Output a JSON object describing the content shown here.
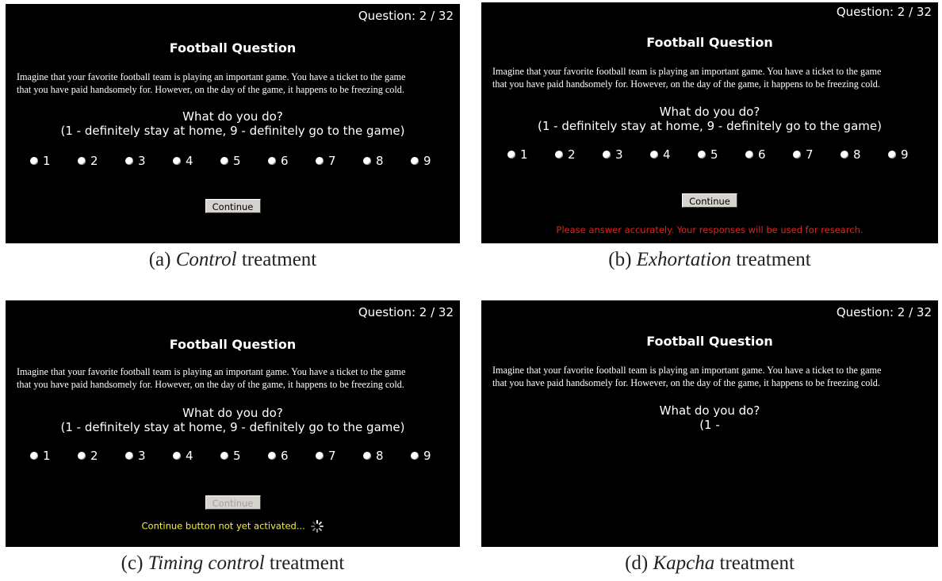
{
  "question_counter": "Question: 2 / 32",
  "question_title": "Football Question",
  "question_text_line1": "Imagine that your favorite football team is playing an important game. You have a ticket to the game",
  "question_text_line2": "that you have paid handsomely for. However, on the day of the game, it happens to be freezing cold.",
  "prompt_line1": "What do you do?",
  "prompt_line2": "(1 - definitely stay at home, 9 - definitely go to the game)",
  "prompt_line2_partial": "(1 -",
  "scale_options": [
    "1",
    "2",
    "3",
    "4",
    "5",
    "6",
    "7",
    "8",
    "9"
  ],
  "continue_label": "Continue",
  "exhortation_message": "Please answer accurately. Your responses will be used for research.",
  "timing_message": "Continue button not yet activated...",
  "captions": {
    "a": {
      "prefix": "(a) ",
      "name": "Control",
      "suffix": " treatment"
    },
    "b": {
      "prefix": "(b) ",
      "name": "Exhortation",
      "suffix": " treatment"
    },
    "c": {
      "prefix": "(c) ",
      "name": "Timing control",
      "suffix": " treatment"
    },
    "d": {
      "prefix": "(d) ",
      "name": "Kapcha",
      "suffix": " treatment"
    }
  },
  "colors": {
    "panel_background": "#000000",
    "exhortation_text": "#e0231c",
    "timing_text": "#f3f23d"
  }
}
